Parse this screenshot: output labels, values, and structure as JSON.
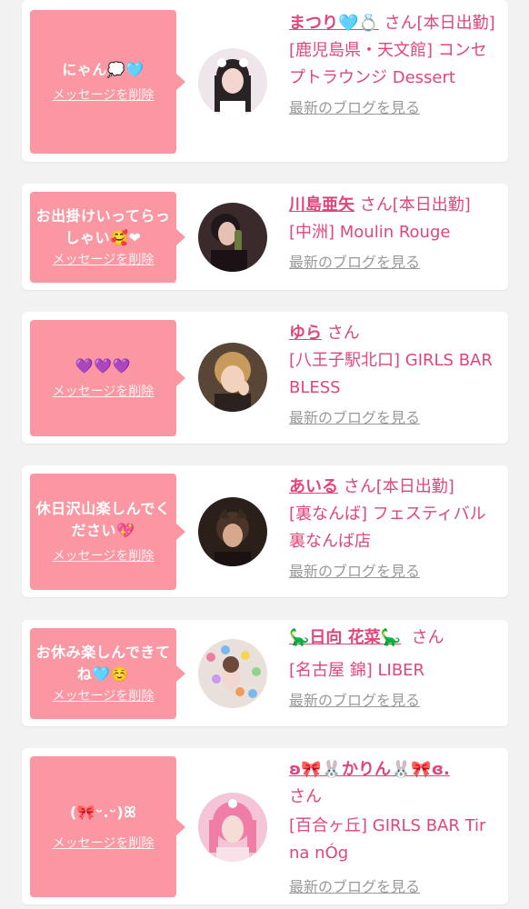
{
  "delete_label": "メッセージを削除",
  "blog_label": "最新のブログを見る",
  "colors": {
    "accent_pink": "#e1467a",
    "bubble_pink": "#fb97a2",
    "muted_gray": "#999999",
    "background": "#f2f2f2"
  },
  "cards": [
    {
      "message": "にゃん💭🩵",
      "name": "まつり🩵💍",
      "suffix": "さん[本日出勤]",
      "shop": "[鹿児島県・天文館] コンセプトラウンジ Dessert",
      "avatar": "avatar-photo"
    },
    {
      "message": "お出掛けいってらっしゃい🥰❤",
      "name": "川島亜矢",
      "suffix": "さん[本日出勤]",
      "shop": "[中洲] Moulin Rouge",
      "avatar": "avatar-photo"
    },
    {
      "message": "💜💜💜",
      "name": "ゆら",
      "suffix": "さん",
      "shop": "[八王子駅北口] GIRLS BAR BLESS",
      "avatar": "avatar-photo"
    },
    {
      "message": "休日沢山楽しんでください💖",
      "name": "あいる",
      "suffix": "さん[本日出勤]",
      "shop": "[裏なんば] フェスティバル 裏なんば店",
      "avatar": "avatar-photo"
    },
    {
      "message": "お休み楽しんできてね🩵☺️",
      "name": "🦕日向 花菜🦕",
      "suffix": "さん",
      "shop": "[名古屋 錦] LIBER",
      "avatar": "avatar-photo"
    },
    {
      "message": "(🎀ᵕ.ᵕ)ꕤ",
      "name": "ʚ🎀🐰かりん🐰🎀ɞ.",
      "suffix": "さん",
      "shop": "[百合ヶ丘] GIRLS BAR Tir na nÓg",
      "avatar": "avatar-photo"
    }
  ]
}
